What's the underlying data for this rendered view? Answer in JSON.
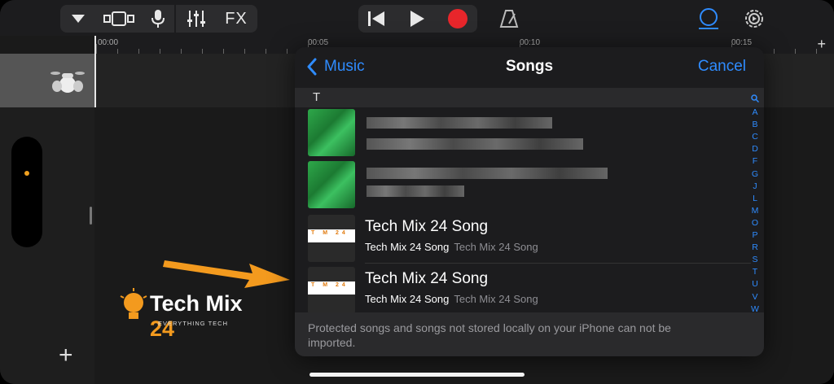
{
  "toolbar": {
    "dropdown_icon": "triangle-down-icon",
    "fx_label": "FX"
  },
  "ruler": {
    "labels": [
      "00:00",
      "00:05",
      "00:10",
      "00:15"
    ]
  },
  "sheet": {
    "back_label": "Music",
    "title": "Songs",
    "cancel_label": "Cancel",
    "section_letter": "T",
    "songs": [
      {
        "title": "Tech Mix 24 Song",
        "artist": "Tech Mix 24 Song",
        "album": "Tech Mix 24 Song",
        "art_text": "T M 24"
      },
      {
        "title": "Tech Mix 24 Song",
        "artist": "Tech Mix 24 Song",
        "album": "Tech Mix 24 Song",
        "art_text": "T M 24"
      }
    ],
    "index_letters": [
      "A",
      "B",
      "C",
      "D",
      "F",
      "G",
      "J",
      "L",
      "M",
      "O",
      "P",
      "R",
      "S",
      "T",
      "U",
      "V",
      "W"
    ],
    "footer_text": "Protected songs and songs not stored locally on your iPhone can not be imported."
  },
  "watermark": {
    "brand": "Tech Mix",
    "brand_number": "24",
    "tagline": "EVERYTHING TECH"
  },
  "colors": {
    "accent": "#2f8cff",
    "record": "#e8262b",
    "arrow": "#f39a1e"
  }
}
